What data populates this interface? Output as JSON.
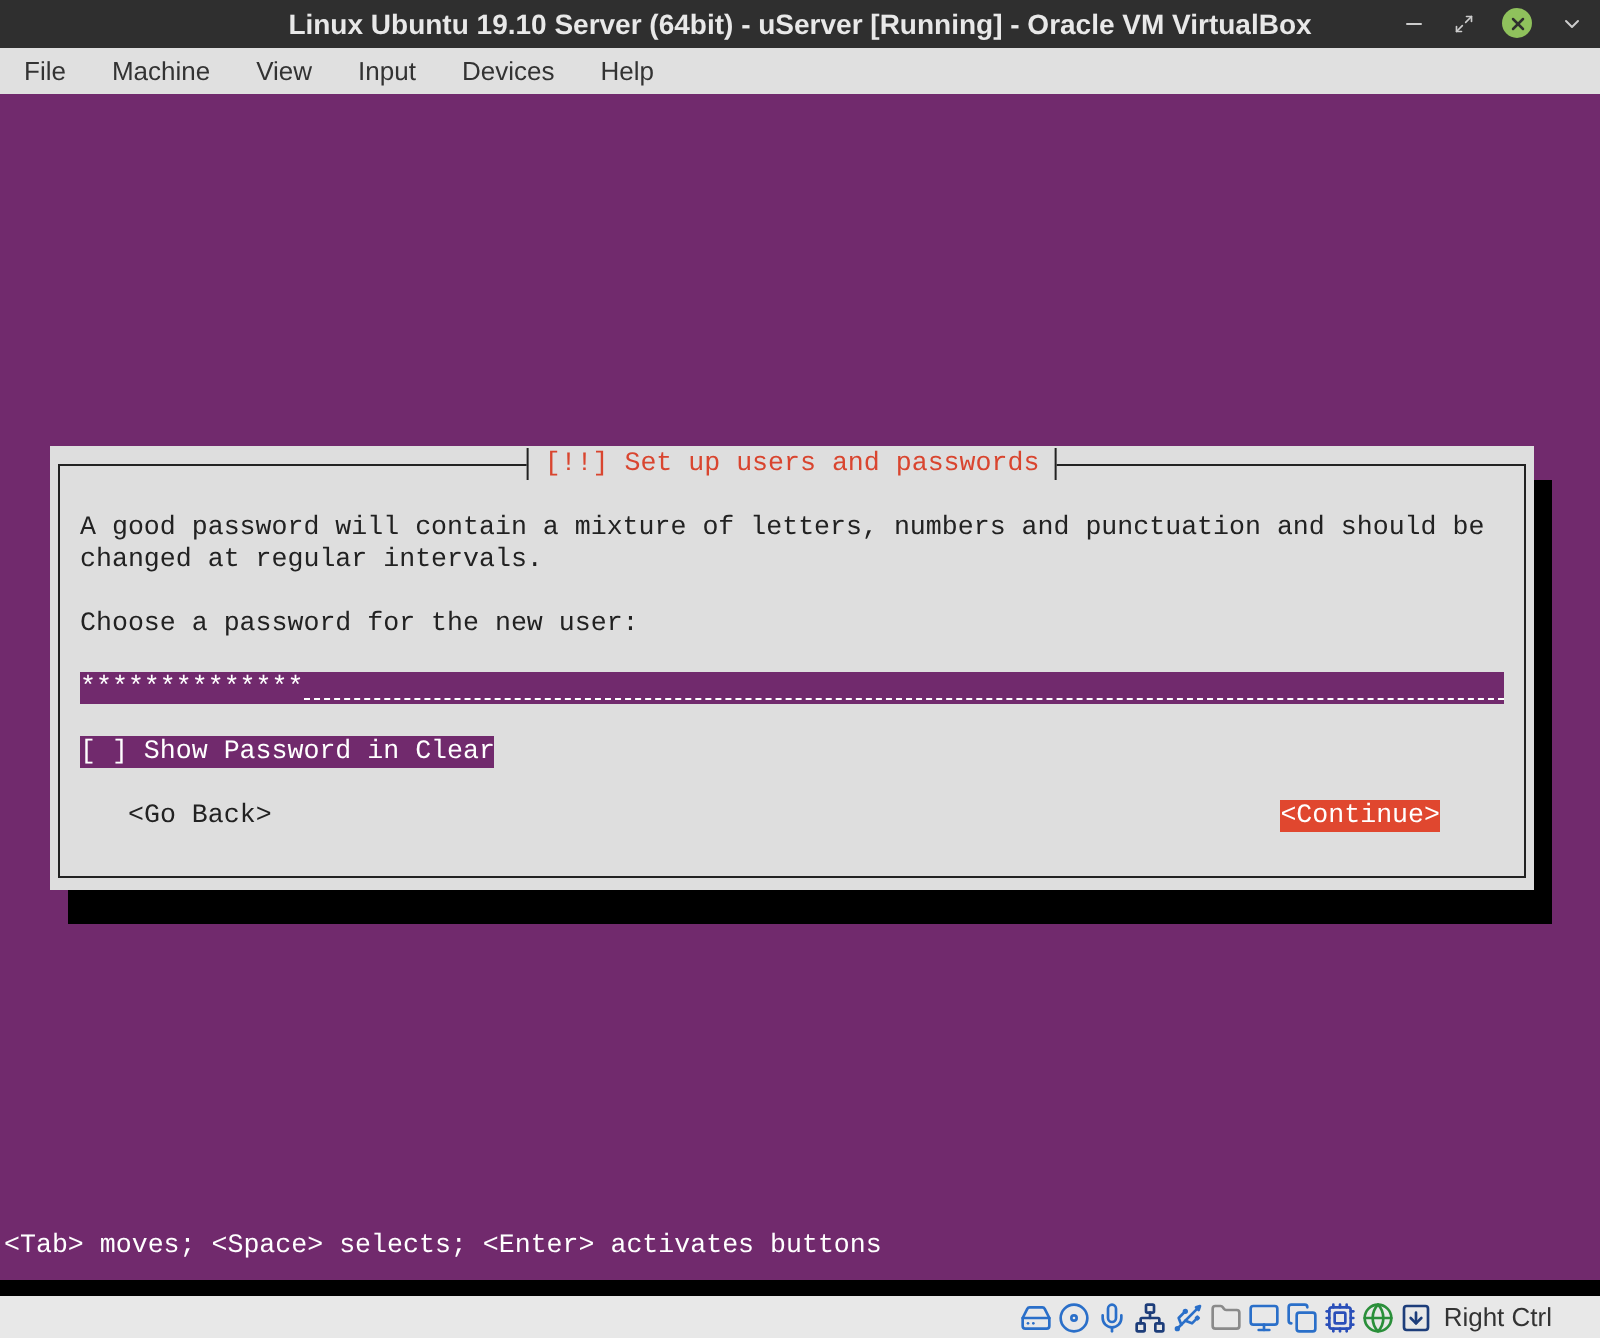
{
  "window": {
    "title": "Linux Ubuntu 19.10 Server (64bit) - uServer [Running] - Oracle VM VirtualBox"
  },
  "menu": [
    "File",
    "Machine",
    "View",
    "Input",
    "Devices",
    "Help"
  ],
  "dialog": {
    "title": "[!!] Set up users and passwords",
    "paragraph": "A good password will contain a mixture of letters, numbers and punctuation and should be changed at regular intervals.",
    "prompt": "Choose a password for the new user:",
    "password": {
      "value": "**************"
    },
    "checkbox": {
      "box": "[ ]",
      "label": "Show Password in Clear",
      "checked": false,
      "focused": true
    },
    "buttons": [
      {
        "label": "<Go Back>",
        "selected": false
      },
      {
        "label": "<Continue>",
        "selected": true
      }
    ]
  },
  "hint": "<Tab> moves; <Space> selects; <Enter> activates buttons",
  "status_bar": {
    "host_key": "Right Ctrl"
  }
}
